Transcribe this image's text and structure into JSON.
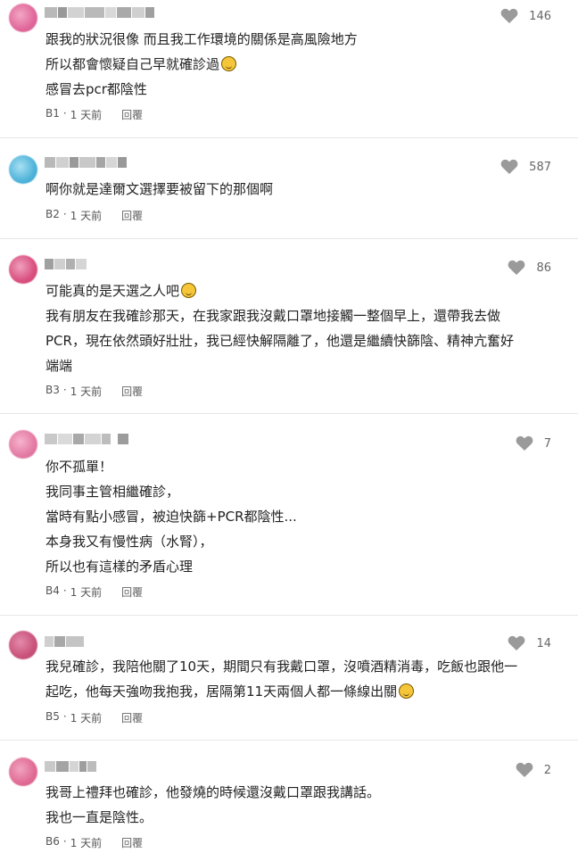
{
  "comments": [
    {
      "floor": "B1",
      "time": "1 天前",
      "likes": "146",
      "lines": [
        "跟我的狀況很像 而且我工作環境的關係是高風險地方",
        "所以都會懷疑自己早就確診過",
        "感冒去pcr都陰性"
      ]
    },
    {
      "floor": "B2",
      "time": "1 天前",
      "likes": "587",
      "lines": [
        "啊你就是達爾文選擇要被留下的那個啊"
      ]
    },
    {
      "floor": "B3",
      "time": "1 天前",
      "likes": "86",
      "lines": [
        "可能真的是天選之人吧",
        "我有朋友在我確診那天，在我家跟我沒戴口罩地接觸一整個早上，還帶我去做",
        "PCR，現在依然頭好壯壯，我已經快解隔離了，他還是繼續快篩陰、精神亢奮好",
        "端端"
      ]
    },
    {
      "floor": "B4",
      "time": "1 天前",
      "likes": "7",
      "lines": [
        "你不孤單！",
        "我同事主管相繼確診，",
        "當時有點小感冒，被迫快篩+PCR都陰性...",
        "本身我又有慢性病（水腎），",
        "所以也有這樣的矛盾心理"
      ]
    },
    {
      "floor": "B5",
      "time": "1 天前",
      "likes": "14",
      "lines": [
        "我兒確診，我陪他關了10天，期間只有我戴口罩，沒噴酒精消毒，吃飯也跟他一",
        "起吃，他每天強吻我抱我，居隔第11天兩個人都一條線出關"
      ]
    },
    {
      "floor": "B6",
      "time": "1 天前",
      "likes": "2",
      "lines": [
        "我哥上禮拜也確診，他發燒的時候還沒戴口罩跟我講話。",
        "我也一直是陰性。"
      ]
    }
  ],
  "separator": "·",
  "reply_label": "回覆",
  "colors": {
    "avatars": [
      "#e0679a",
      "#4fb3d9",
      "#d94f7e",
      "#e37aa3",
      "#c9527a",
      "#e06a94"
    ],
    "heart": "#9a9a9a"
  },
  "icons": {
    "like": "heart-icon",
    "emoji": "laughing-emoji-icon"
  }
}
